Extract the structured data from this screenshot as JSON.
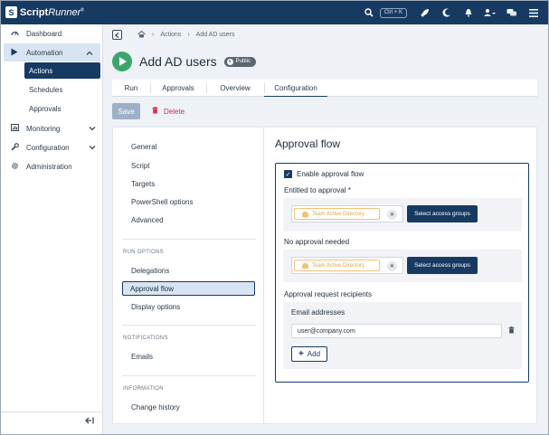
{
  "app": {
    "logo_mark": "S",
    "name": "Script",
    "name_italic": "Runner",
    "trademark": "®"
  },
  "topbar": {
    "search_shortcut": "Ctrl + K"
  },
  "sidebar": {
    "dashboard": "Dashboard",
    "automation": "Automation",
    "automation_sub": [
      "Actions",
      "Schedules",
      "Approvals"
    ],
    "monitoring": "Monitoring",
    "configuration": "Configuration",
    "administration": "Administration"
  },
  "breadcrumb": {
    "actions": "Actions",
    "current": "Add AD users"
  },
  "page": {
    "title": "Add AD users",
    "badge": "Public"
  },
  "tabs": [
    "Run",
    "Approvals",
    "Overview",
    "Configuration"
  ],
  "toolbar": {
    "save_label": "Save",
    "delete_label": "Delete"
  },
  "config_nav": {
    "general": [
      "General",
      "Script",
      "Targets",
      "PowerShell options",
      "Advanced"
    ],
    "run_options_header": "RUN OPTIONS",
    "run_options": [
      "Delegations",
      "Approval flow",
      "Display options"
    ],
    "notifications_header": "NOTIFICATIONS",
    "notifications": [
      "Emails"
    ],
    "information_header": "INFORMATION",
    "information": [
      "Change history"
    ]
  },
  "approval_flow": {
    "title": "Approval flow",
    "enable_label": "Enable approval flow",
    "entitled_label": "Entitled to approval *",
    "entitled_group": "Team Active Directory",
    "no_approval_label": "No approval needed",
    "no_approval_group": "Team Active Directory",
    "select_groups_label": "Select access groups",
    "recipients_label": "Approval request recipients",
    "email_label": "Email addresses",
    "email_value": "user@company.com",
    "add_label": "Add"
  }
}
